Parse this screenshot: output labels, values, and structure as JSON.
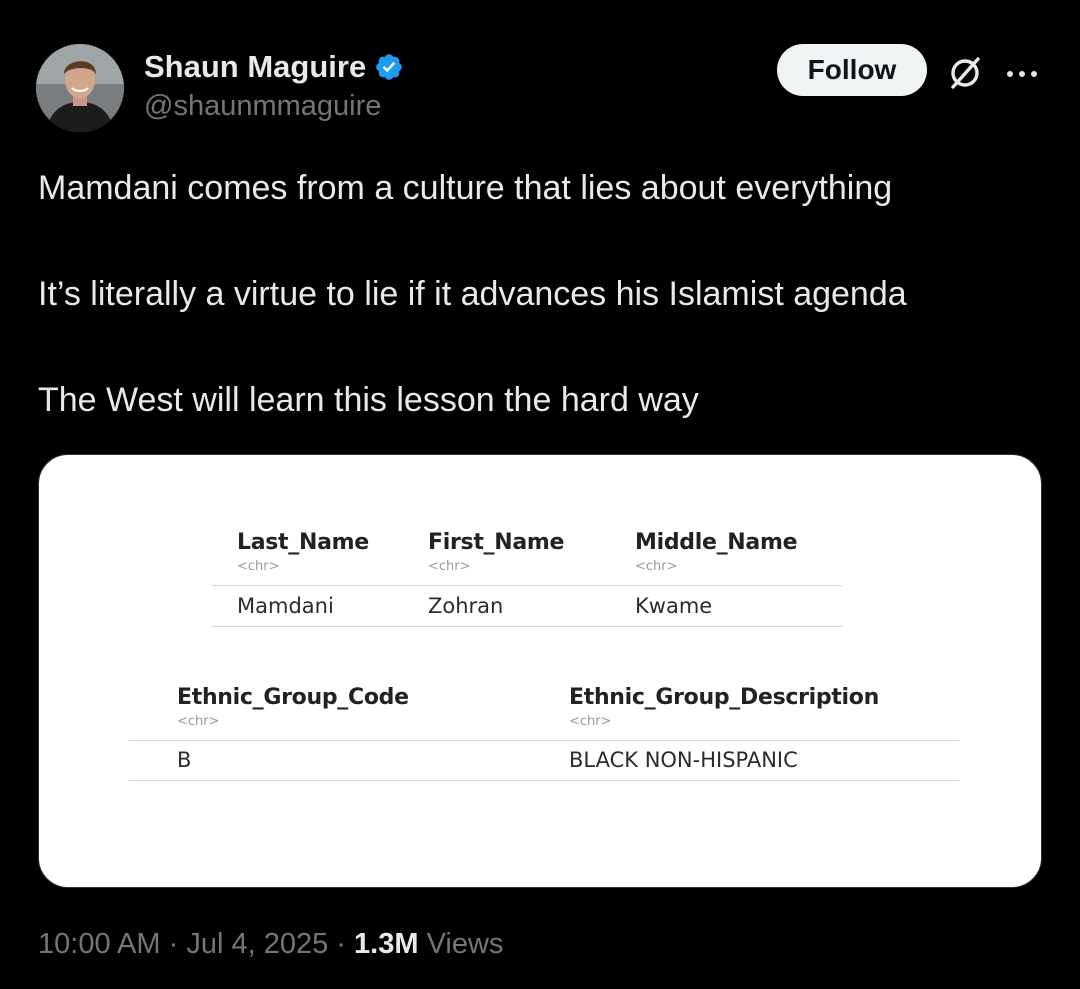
{
  "user": {
    "display_name": "Shaun Maguire",
    "handle": "@shaunmmaguire",
    "avatar_icon": "profile-photo",
    "verified_icon": "verified-badge-icon",
    "verified_color": "#1d9bf0"
  },
  "header": {
    "follow_label": "Follow",
    "grok_icon": "grok-icon",
    "more_icon": "more-options-icon"
  },
  "tweet": {
    "paragraphs": [
      "Mamdani comes from a culture that lies about everything",
      "It’s literally a virtue to lie if it advances his Islamist agenda",
      "The West will learn this lesson the hard way"
    ]
  },
  "media": {
    "table1": {
      "headers": [
        "Last_Name",
        "First_Name",
        "Middle_Name"
      ],
      "types": [
        "<chr>",
        "<chr>",
        "<chr>"
      ],
      "row": [
        "Mamdani",
        "Zohran",
        "Kwame"
      ]
    },
    "table2": {
      "headers": [
        "Ethnic_Group_Code",
        "Ethnic_Group_Description"
      ],
      "types": [
        "<chr>",
        "<chr>"
      ],
      "row": [
        "B",
        "BLACK NON-HISPANIC"
      ]
    }
  },
  "footer": {
    "time": "10:00 AM",
    "separator": "·",
    "date": "Jul 4, 2025",
    "views_count": "1.3M",
    "views_label": "Views"
  },
  "colors": {
    "background": "#000000",
    "text_primary": "#e7e9ea",
    "text_secondary": "#71767b",
    "follow_button_bg": "#eff3f4"
  }
}
